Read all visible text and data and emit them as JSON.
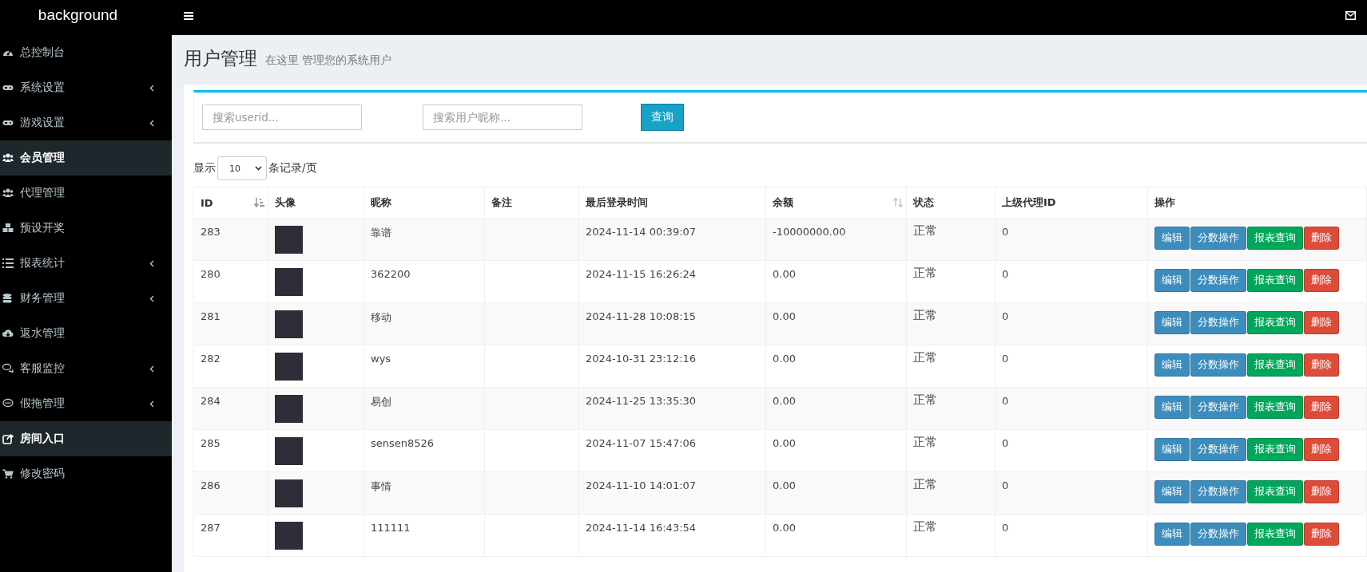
{
  "brand": "background",
  "sidebar": {
    "items": [
      {
        "label": "总控制台",
        "expandable": false,
        "selected": false
      },
      {
        "label": "系统设置",
        "expandable": true,
        "selected": false
      },
      {
        "label": "游戏设置",
        "expandable": true,
        "selected": false
      },
      {
        "label": "会员管理",
        "expandable": false,
        "selected": true
      },
      {
        "label": "代理管理",
        "expandable": false,
        "selected": false
      },
      {
        "label": "预设开奖",
        "expandable": false,
        "selected": false
      },
      {
        "label": "报表统计",
        "expandable": true,
        "selected": false
      },
      {
        "label": "财务管理",
        "expandable": true,
        "selected": false
      },
      {
        "label": "返水管理",
        "expandable": false,
        "selected": false
      },
      {
        "label": "客服监控",
        "expandable": true,
        "selected": false
      },
      {
        "label": "假拖管理",
        "expandable": true,
        "selected": false
      },
      {
        "label": "房间入口",
        "expandable": false,
        "selected": true
      },
      {
        "label": "修改密码",
        "expandable": false,
        "selected": false
      }
    ]
  },
  "page": {
    "title": "用户管理",
    "subtitle": "在这里 管理您的系统用户"
  },
  "search": {
    "fields": [
      {
        "placeholder": "搜索userid..."
      },
      {
        "placeholder": "搜索用户昵称..."
      }
    ],
    "button": "查询"
  },
  "page_size": {
    "prefix": "显示",
    "value": "10",
    "suffix": "条记录/页"
  },
  "table": {
    "columns": [
      {
        "label": "ID",
        "sortable": true
      },
      {
        "label": "头像",
        "sortable": false
      },
      {
        "label": "昵称",
        "sortable": false
      },
      {
        "label": "备注",
        "sortable": false
      },
      {
        "label": "最后登录时间",
        "sortable": false
      },
      {
        "label": "余额",
        "sortable": true
      },
      {
        "label": "状态",
        "sortable": false
      },
      {
        "label": "上级代理ID",
        "sortable": false
      },
      {
        "label": "操作",
        "sortable": false
      }
    ],
    "rows": [
      {
        "id": "283",
        "nickname": "靠谱",
        "remark": "",
        "last_login": "2024-11-14 00:39:07",
        "balance": "-10000000.00",
        "status": "正常",
        "parent_id": "0",
        "actions": [
          {
            "label": "编辑",
            "kind": "primary"
          },
          {
            "label": "分数操作",
            "kind": "primary"
          },
          {
            "label": "报表查询",
            "kind": "success"
          },
          {
            "label": "删除",
            "kind": "danger"
          }
        ]
      },
      {
        "id": "280",
        "nickname": "362200",
        "remark": "",
        "last_login": "2024-11-15 16:26:24",
        "balance": "0.00",
        "status": "正常",
        "parent_id": "0",
        "actions": [
          {
            "label": "编辑",
            "kind": "primary"
          },
          {
            "label": "分数操作",
            "kind": "primary"
          },
          {
            "label": "报表查询",
            "kind": "success"
          },
          {
            "label": "删除",
            "kind": "danger"
          }
        ]
      },
      {
        "id": "281",
        "nickname": "移动",
        "remark": "",
        "last_login": "2024-11-28 10:08:15",
        "balance": "0.00",
        "status": "正常",
        "parent_id": "0",
        "actions": [
          {
            "label": "编辑",
            "kind": "primary"
          },
          {
            "label": "分数操作",
            "kind": "primary"
          },
          {
            "label": "报表查询",
            "kind": "success"
          },
          {
            "label": "删除",
            "kind": "danger"
          }
        ]
      },
      {
        "id": "282",
        "nickname": "wys",
        "remark": "",
        "last_login": "2024-10-31 23:12:16",
        "balance": "0.00",
        "status": "正常",
        "parent_id": "0",
        "actions": [
          {
            "label": "编辑",
            "kind": "primary"
          },
          {
            "label": "分数操作",
            "kind": "primary"
          },
          {
            "label": "报表查询",
            "kind": "success"
          },
          {
            "label": "删除",
            "kind": "danger"
          }
        ]
      },
      {
        "id": "284",
        "nickname": "易创",
        "remark": "",
        "last_login": "2024-11-25 13:35:30",
        "balance": "0.00",
        "status": "正常",
        "parent_id": "0",
        "actions": [
          {
            "label": "编辑",
            "kind": "primary"
          },
          {
            "label": "分数操作",
            "kind": "primary"
          },
          {
            "label": "报表查询",
            "kind": "success"
          },
          {
            "label": "删除",
            "kind": "danger"
          }
        ]
      },
      {
        "id": "285",
        "nickname": "sensen8526",
        "remark": "",
        "last_login": "2024-11-07 15:47:06",
        "balance": "0.00",
        "status": "正常",
        "parent_id": "0",
        "actions": [
          {
            "label": "编辑",
            "kind": "primary"
          },
          {
            "label": "分数操作",
            "kind": "primary"
          },
          {
            "label": "报表查询",
            "kind": "success"
          },
          {
            "label": "删除",
            "kind": "danger"
          }
        ]
      },
      {
        "id": "286",
        "nickname": "事情",
        "remark": "",
        "last_login": "2024-11-10 14:01:07",
        "balance": "0.00",
        "status": "正常",
        "parent_id": "0",
        "actions": [
          {
            "label": "编辑",
            "kind": "primary"
          },
          {
            "label": "分数操作",
            "kind": "primary"
          },
          {
            "label": "报表查询",
            "kind": "success"
          },
          {
            "label": "删除",
            "kind": "danger"
          }
        ]
      },
      {
        "id": "287",
        "nickname": "111111",
        "remark": "",
        "last_login": "2024-11-14 16:43:54",
        "balance": "0.00",
        "status": "正常",
        "parent_id": "0",
        "actions": [
          {
            "label": "编辑",
            "kind": "primary"
          },
          {
            "label": "分数操作",
            "kind": "primary"
          },
          {
            "label": "报表查询",
            "kind": "success"
          },
          {
            "label": "删除",
            "kind": "danger"
          }
        ]
      }
    ]
  }
}
